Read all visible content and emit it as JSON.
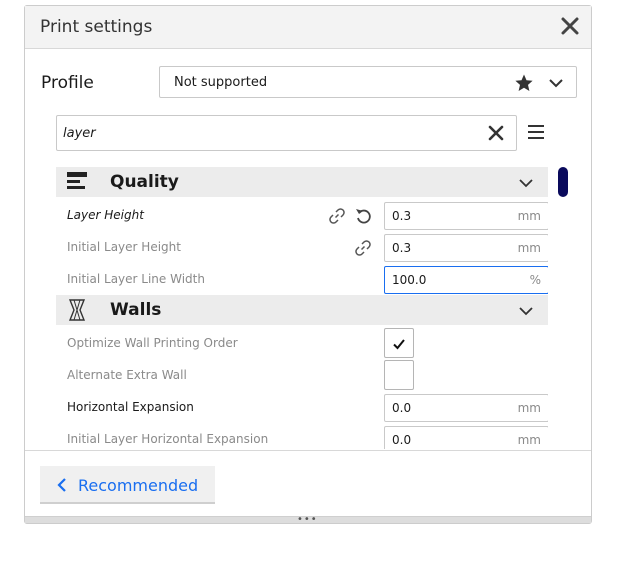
{
  "header": {
    "title": "Print settings"
  },
  "profile": {
    "label": "Profile",
    "value": "Not supported"
  },
  "search": {
    "value": "layer"
  },
  "categories": [
    {
      "title": "Quality",
      "icon": "quality-icon",
      "settings": [
        {
          "label": "Layer Height",
          "value": "0.3",
          "unit": "mm"
        },
        {
          "label": "Initial Layer Height",
          "value": "0.3",
          "unit": "mm"
        },
        {
          "label": "Initial Layer Line Width",
          "value": "100.0",
          "unit": "%"
        }
      ]
    },
    {
      "title": "Walls",
      "icon": "walls-icon",
      "settings": [
        {
          "label": "Optimize Wall Printing Order",
          "checked": true
        },
        {
          "label": "Alternate Extra Wall",
          "checked": false
        },
        {
          "label": "Horizontal Expansion",
          "value": "0.0",
          "unit": "mm"
        },
        {
          "label": "Initial Layer Horizontal Expansion",
          "value": "0.0",
          "unit": "mm"
        }
      ]
    }
  ],
  "footer": {
    "recommended_label": "Recommended",
    "resize_handle": "•••"
  },
  "colors": {
    "accent": "#196ef0",
    "scroll_thumb": "#0a0a5c"
  }
}
